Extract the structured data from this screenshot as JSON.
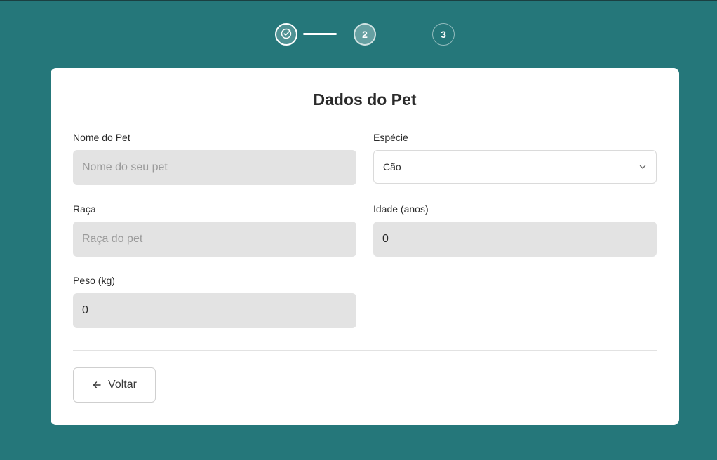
{
  "stepper": {
    "steps": [
      {
        "label": "",
        "state": "done",
        "icon": "check-circle-icon"
      },
      {
        "label": "2",
        "state": "active"
      },
      {
        "label": "3",
        "state": "pending"
      }
    ]
  },
  "form": {
    "title": "Dados do Pet",
    "nome": {
      "label": "Nome do Pet",
      "placeholder": "Nome do seu pet",
      "value": ""
    },
    "especie": {
      "label": "Espécie",
      "value": "Cão",
      "icon": "chevron-down-icon"
    },
    "raca": {
      "label": "Raça",
      "placeholder": "Raça do pet",
      "value": ""
    },
    "idade": {
      "label": "Idade (anos)",
      "value": "0"
    },
    "peso": {
      "label": "Peso (kg)",
      "value": "0"
    }
  },
  "actions": {
    "back_label": "Voltar",
    "back_icon": "arrow-left-icon"
  },
  "colors": {
    "background": "#25777a",
    "card": "#ffffff",
    "input_fill": "#e3e3e3"
  }
}
